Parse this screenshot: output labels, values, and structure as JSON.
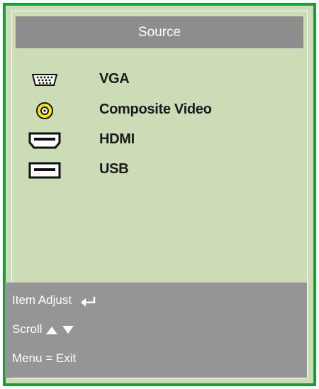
{
  "menu": {
    "title": "Source",
    "items": [
      {
        "label": "VGA",
        "icon": "vga-port-icon"
      },
      {
        "label": "Composite Video",
        "icon": "rca-jack-icon"
      },
      {
        "label": "HDMI",
        "icon": "hdmi-port-icon"
      },
      {
        "label": "USB",
        "icon": "usb-port-icon"
      }
    ]
  },
  "help": {
    "item_adjust": "Item Adjust",
    "scroll": "Scroll",
    "exit": "Menu = Exit",
    "icons": [
      "enter-icon",
      "up-arrow-icon",
      "down-arrow-icon"
    ]
  },
  "colors": {
    "frame": "#1e9a3a",
    "background": "#ccdcb7",
    "title_bar": "#8d8d8d",
    "help_panel": "#959595",
    "rca_yellow": "#f4e800"
  }
}
